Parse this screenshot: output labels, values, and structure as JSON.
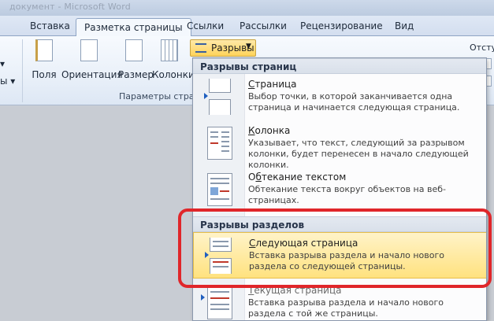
{
  "window": {
    "title_partial": "документ - Microsoft Word"
  },
  "tabs": [
    {
      "label": "Вставка"
    },
    {
      "label": "Разметка страницы"
    },
    {
      "label": "Ссылки"
    },
    {
      "label": "Рассылки"
    },
    {
      "label": "Рецензирование"
    },
    {
      "label": "Вид"
    }
  ],
  "ribbon": {
    "buttons": [
      {
        "label": "Поля"
      },
      {
        "label": "Ориентация"
      },
      {
        "label": "Размер"
      },
      {
        "label": "Колонки"
      }
    ],
    "group_label": "Параметры страни",
    "breaks_label": "Разрывы",
    "right_label": "Отсту"
  },
  "menu": {
    "section1": "Разрывы страниц",
    "section2": "Разрывы разделов",
    "items": [
      {
        "title": "Страница",
        "underline": "С",
        "desc": "Выбор точки, в которой заканчивается одна страница и начинается следующая страница."
      },
      {
        "title": "Колонка",
        "underline": "К",
        "desc": "Указывает, что текст, следующий за разрывом колонки, будет перенесен в начало следующей колонки."
      },
      {
        "title": "Обтекание текстом",
        "underline": "б",
        "desc": "Обтекание текста вокруг объектов на веб-страницах."
      },
      {
        "title": "Следующая страница",
        "underline": "С",
        "desc": "Вставка разрыва раздела и начало нового раздела со следующей страницы."
      },
      {
        "title": "Текущая страница",
        "underline": "Т",
        "desc": "Вставка разрыва раздела и начало нового раздела с той же страницы."
      }
    ]
  },
  "highlight_color": "#e0262a"
}
